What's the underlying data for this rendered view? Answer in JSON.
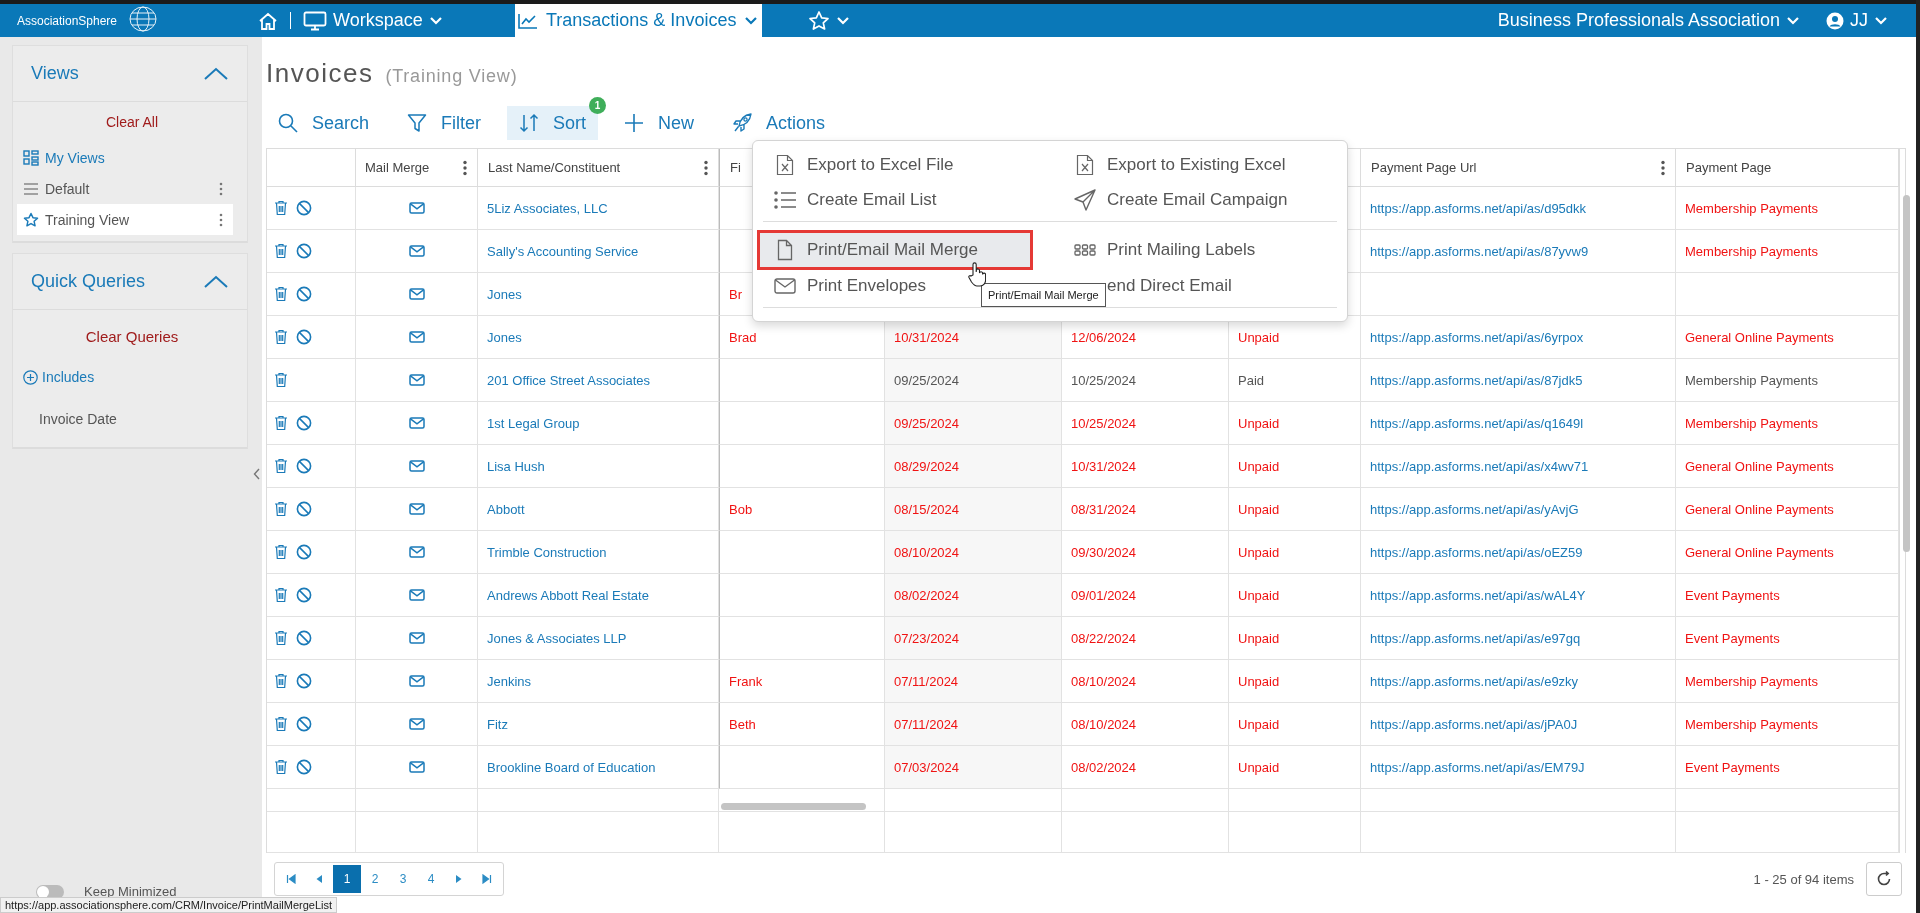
{
  "top_bar": {
    "logo": "AssociationSphere",
    "workspace": "Workspace",
    "tabs": [
      {
        "label": "Transactions & Invoices",
        "selected": true
      }
    ],
    "organization": "Business Professionals Association",
    "user": "JJ"
  },
  "sidebar": {
    "views": {
      "title": "Views",
      "expanded": true,
      "clear": "Clear All",
      "items": [
        {
          "label": "My Views",
          "kind": "group",
          "selected": false
        },
        {
          "label": "Default",
          "kind": "list",
          "selected": false
        },
        {
          "label": "Training View",
          "kind": "favorite",
          "selected": true
        }
      ]
    },
    "quick_queries": {
      "title": "Quick Queries",
      "expanded": true,
      "clear": "Clear Queries",
      "add": "Includes",
      "items": [
        "Invoice Date"
      ]
    },
    "keep_minimized": {
      "label": "Keep Minimized",
      "on": false
    }
  },
  "page": {
    "title": "Invoices",
    "subtitle": "(Training View)"
  },
  "toolbar": [
    {
      "label": "Search",
      "kind": "search",
      "active": false
    },
    {
      "label": "Filter",
      "kind": "filter",
      "active": false
    },
    {
      "label": "Sort",
      "kind": "sort",
      "active": true,
      "badge": "1"
    },
    {
      "label": "New",
      "kind": "new",
      "active": false
    },
    {
      "label": "Actions",
      "kind": "actions",
      "active": false
    }
  ],
  "actions_menu": {
    "sections": [
      {
        "items": [
          {
            "label": "Export to Excel File",
            "kind": "excel",
            "highlighted": false
          },
          {
            "label": "Export to Existing Excel",
            "kind": "excel",
            "highlighted": false
          },
          {
            "label": "Create Email List",
            "kind": "list",
            "highlighted": false
          },
          {
            "label": "Create Email Campaign",
            "kind": "send",
            "highlighted": false
          }
        ]
      },
      {
        "items": [
          {
            "label": "Print/Email Mail Merge",
            "kind": "file",
            "highlighted": true
          },
          {
            "label": "Print Mailing Labels",
            "kind": "labels",
            "highlighted": false
          },
          {
            "label": "Print Envelopes",
            "kind": "envelope",
            "highlighted": false
          },
          {
            "label": "end Direct Email",
            "highlighted": false
          }
        ]
      }
    ],
    "tooltip": "Print/Email Mail Merge"
  },
  "table": {
    "columns": [
      {
        "menu": false
      },
      {
        "label": "Mail Merge",
        "menu": true
      },
      {
        "label": "Last Name/Constituent",
        "menu": true
      },
      {
        "label": "Fi"
      },
      {},
      {},
      {},
      {
        "label": "Payment Page Url",
        "menu": true
      },
      {
        "label": "Payment Page",
        "menu": false
      }
    ],
    "rows": [
      {
        "cancelable": true,
        "overdue": true,
        "last_name": "5Liz Associates, LLC",
        "payment_url": "https://app.asforms.net/api/as/d95dkk",
        "payment_page": "Membership Payments"
      },
      {
        "cancelable": true,
        "overdue": true,
        "last_name": "Sally's Accounting Service",
        "payment_url": "https://app.asforms.net/api/as/87yvw9",
        "payment_page": "Membership Payments"
      },
      {
        "cancelable": true,
        "overdue": true,
        "last_name": "Jones",
        "first_name": "Br"
      },
      {
        "cancelable": true,
        "overdue": true,
        "last_name": "Jones",
        "first_name": "Brad",
        "invoice_date": "10/31/2024",
        "due_date": "12/06/2024",
        "status": "Unpaid",
        "payment_url": "https://app.asforms.net/api/as/6yrpox",
        "payment_page": "General Online Payments"
      },
      {
        "cancelable": false,
        "overdue": false,
        "last_name": "201 Office Street Associates",
        "invoice_date": "09/25/2024",
        "due_date": "10/25/2024",
        "status": "Paid",
        "payment_url": "https://app.asforms.net/api/as/87jdk5",
        "payment_page": "Membership Payments"
      },
      {
        "cancelable": true,
        "overdue": true,
        "last_name": "1st Legal Group",
        "invoice_date": "09/25/2024",
        "due_date": "10/25/2024",
        "status": "Unpaid",
        "payment_url": "https://app.asforms.net/api/as/q1649l",
        "payment_page": "Membership Payments"
      },
      {
        "cancelable": true,
        "overdue": true,
        "last_name": "Lisa Hush",
        "invoice_date": "08/29/2024",
        "due_date": "10/31/2024",
        "status": "Unpaid",
        "payment_url": "https://app.asforms.net/api/as/x4wv71",
        "payment_page": "General Online Payments"
      },
      {
        "cancelable": true,
        "overdue": true,
        "last_name": "Abbott",
        "first_name": "Bob",
        "invoice_date": "08/15/2024",
        "due_date": "08/31/2024",
        "status": "Unpaid",
        "payment_url": "https://app.asforms.net/api/as/yAvjG",
        "payment_page": "General Online Payments"
      },
      {
        "cancelable": true,
        "overdue": true,
        "last_name": "Trimble Construction",
        "invoice_date": "08/10/2024",
        "due_date": "09/30/2024",
        "status": "Unpaid",
        "payment_url": "https://app.asforms.net/api/as/oEZ59",
        "payment_page": "General Online Payments"
      },
      {
        "cancelable": true,
        "overdue": true,
        "last_name": "Andrews Abbott Real Estate",
        "invoice_date": "08/02/2024",
        "due_date": "09/01/2024",
        "status": "Unpaid",
        "payment_url": "https://app.asforms.net/api/as/wAL4Y",
        "payment_page": "Event Payments"
      },
      {
        "cancelable": true,
        "overdue": true,
        "last_name": "Jones & Associates LLP",
        "invoice_date": "07/23/2024",
        "due_date": "08/22/2024",
        "status": "Unpaid",
        "payment_url": "https://app.asforms.net/api/as/e97gq",
        "payment_page": "Event Payments"
      },
      {
        "cancelable": true,
        "overdue": true,
        "last_name": "Jenkins",
        "first_name": "Frank",
        "invoice_date": "07/11/2024",
        "due_date": "08/10/2024",
        "status": "Unpaid",
        "payment_url": "https://app.asforms.net/api/as/e9zky",
        "payment_page": "Membership Payments"
      },
      {
        "cancelable": true,
        "overdue": true,
        "last_name": "Fitz",
        "first_name": "Beth",
        "invoice_date": "07/11/2024",
        "due_date": "08/10/2024",
        "status": "Unpaid",
        "payment_url": "https://app.asforms.net/api/as/jPA0J",
        "payment_page": "Membership Payments"
      },
      {
        "cancelable": true,
        "overdue": true,
        "last_name": "Brookline Board of Education",
        "invoice_date": "07/03/2024",
        "due_date": "08/02/2024",
        "status": "Unpaid",
        "payment_url": "https://app.asforms.net/api/as/EM79J",
        "payment_page": "Event Payments"
      }
    ]
  },
  "pagination": {
    "pages": [
      {
        "label": "1",
        "selected": true
      },
      {
        "label": "2",
        "selected": false
      },
      {
        "label": "3",
        "selected": false
      },
      {
        "label": "4",
        "selected": false
      }
    ],
    "summary": "1 - 25 of 94 items"
  },
  "status_url": "https://app.associationsphere.com/CRM/Invoice/PrintMailMergeList"
}
